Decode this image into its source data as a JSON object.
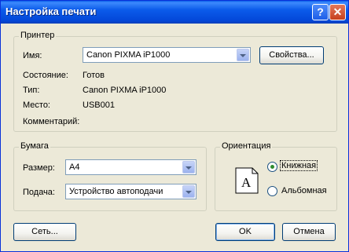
{
  "window": {
    "title": "Настройка печати",
    "help_btn": "?",
    "close_btn": "✕"
  },
  "printer": {
    "group_title": "Принтер",
    "name_label": "Имя:",
    "name_value": "Canon PIXMA iP1000",
    "properties_btn": "Свойства...",
    "status_label": "Состояние:",
    "status_value": "Готов",
    "type_label": "Тип:",
    "type_value": "Canon PIXMA iP1000",
    "where_label": "Место:",
    "where_value": "USB001",
    "comment_label": "Комментарий:",
    "comment_value": ""
  },
  "paper": {
    "group_title": "Бумага",
    "size_label": "Размер:",
    "size_value": "A4",
    "source_label": "Подача:",
    "source_value": "Устройство автоподачи"
  },
  "orientation": {
    "group_title": "Ориентация",
    "portrait_label": "Книжная",
    "landscape_label": "Альбомная",
    "selected": "portrait",
    "preview_letter": "A"
  },
  "buttons": {
    "network": "Сеть...",
    "ok": "OK",
    "cancel": "Отмена"
  }
}
